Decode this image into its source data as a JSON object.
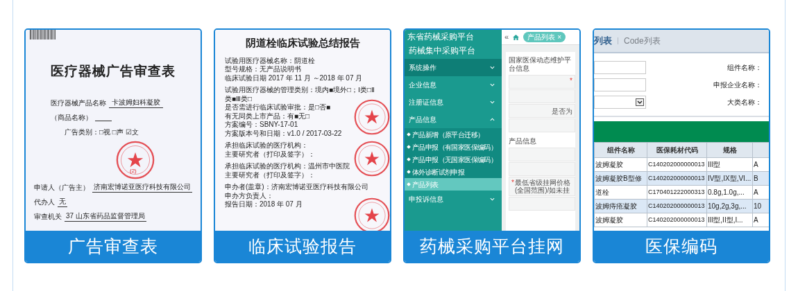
{
  "cards": [
    {
      "kind": "ad_form",
      "caption": "广告审查表",
      "title": "医疗器械广告审查表",
      "fields": [
        {
          "label": "医疗器械产品名称",
          "value": "卡波姆妇科凝胶"
        },
        {
          "label": "（商品名称）"
        }
      ],
      "ad_type": "广告类别：□视 □声 ☑文",
      "parties": [
        {
          "label": "申请人（广告主）",
          "value": "济南宏博诺亚医疗科技有限公司"
        },
        {
          "label": "代办人",
          "value": "无"
        },
        {
          "label": "审查机关",
          "value": "37 山东省药品监督管理局"
        }
      ],
      "stamp": "(2)"
    },
    {
      "kind": "report",
      "caption": "临床试验报告",
      "title": "阴道栓临床试验总结报告",
      "groups": [
        [
          "试验用医疗器械名称：阴道栓",
          "型号规格：无产品说明书",
          "临床试验日期 2017 年 11 月 ～2018 年 07 月"
        ],
        [
          "试验用医疗器械的管理类别：境内■境外□；Ⅰ类□Ⅱ类■Ⅲ类□",
          "是否需进行临床试验审批：是□否■",
          "有无同类上市产品：有■无□",
          "方案编号：SBNY-17-01",
          "方案版本号和日期：v1.0 / 2017-03-22"
        ],
        [
          "承担临床试验的医疗机构：",
          "主要研究者（打印及签字）："
        ],
        [
          "承担临床试验的医疗机构：温州市中医院",
          "主要研究者（打印及签字）："
        ],
        [
          "申办者(盖章)：济南宏博诺亚医疗科技有限公司",
          "申办方负责人：",
          "报告日期：2018 年 07 月"
        ]
      ]
    },
    {
      "kind": "portal",
      "caption": "药械采购平台挂网",
      "brand": [
        "东省药械采购平台",
        "药械集中采购平台"
      ],
      "menu": [
        {
          "label": "系统操作",
          "expanded": false
        },
        {
          "label": "企业信息",
          "expanded": false
        },
        {
          "label": "注册证信息",
          "expanded": false
        },
        {
          "label": "产品信息",
          "expanded": true,
          "children": [
            {
              "label": "产品新增（原平台迁移）",
              "selected": false
            },
            {
              "label": "产品申报（有国家医保编码）",
              "selected": false
            },
            {
              "label": "产品申报（无国家医保编码）",
              "selected": false
            },
            {
              "label": "体外诊断试剂申报",
              "selected": false
            },
            {
              "label": "产品列表",
              "selected": true
            }
          ]
        },
        {
          "label": "申投诉信息",
          "expanded": false
        }
      ],
      "toolbar": {
        "collapse": "«",
        "tab": "产品列表",
        "tab_close": "×"
      },
      "sections": [
        {
          "heading": "国家医保动态维护平台信息",
          "rows": [
            {
              "kind": "field",
              "marker": "*"
            },
            {
              "kind": "empty"
            },
            {
              "kind": "field",
              "label": "是否为"
            },
            {
              "kind": "empty"
            }
          ]
        },
        {
          "heading": "产品信息",
          "rows": [
            {
              "kind": "empty"
            },
            {
              "kind": "empty"
            },
            {
              "kind": "field",
              "marker": "*",
              "label": "最低省级挂网价格(全国范围)/如未挂"
            },
            {
              "kind": "empty"
            }
          ]
        }
      ]
    },
    {
      "kind": "code_list",
      "caption": "医保编码",
      "tabs": [
        {
          "label": "列表",
          "selected": true
        },
        {
          "label": "Code列表",
          "selected": false
        }
      ],
      "filters": [
        {
          "label": "组件名称：",
          "kind": "text"
        },
        {
          "label": "申报企业名称：",
          "kind": "text"
        },
        {
          "label": "大类名称：",
          "kind": "select"
        }
      ],
      "table": {
        "columns": [
          "组件名称",
          "医保耗材代码",
          "规格"
        ],
        "rows": [
          [
            "波姆凝胶",
            "C140202000000013",
            "III型",
            "A"
          ],
          [
            "波姆凝胶B型修",
            "C140202000000013",
            "IV型,IX型,VI...",
            "B"
          ],
          [
            "道栓",
            "C170401222000313",
            "0.8g,1.0g,...",
            "A"
          ],
          [
            "波姆痔疮凝胶",
            "C140202000000013",
            "10g,2g,3g,...",
            "10"
          ],
          [
            "波姆凝胶",
            "C140202000000013",
            "III型,II型,I...",
            "A"
          ]
        ]
      }
    }
  ]
}
